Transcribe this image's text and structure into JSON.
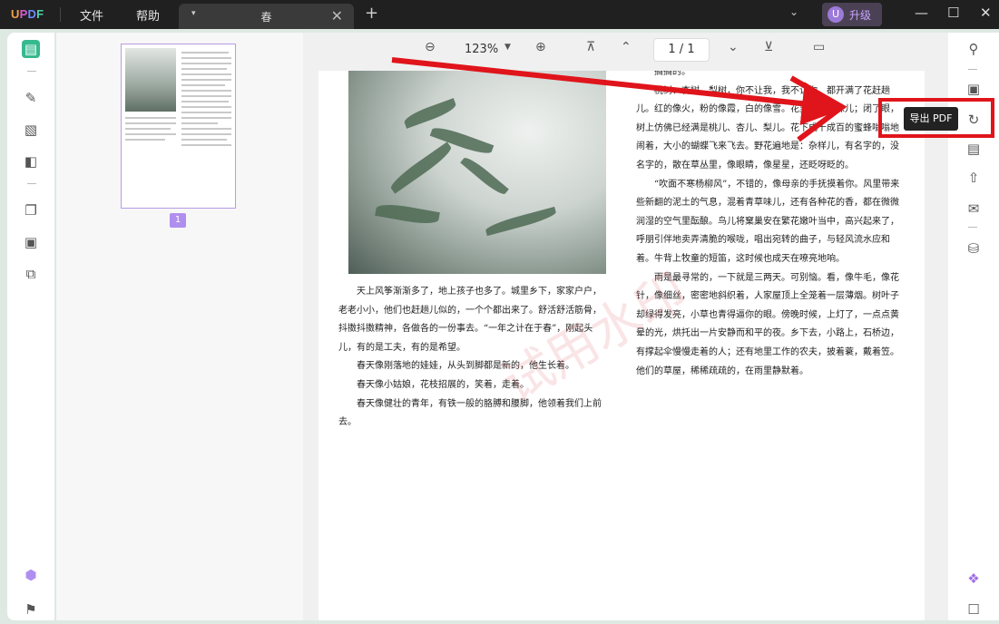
{
  "titlebar": {
    "logo": {
      "u": "U",
      "p": "P",
      "d": "D",
      "f": "F"
    },
    "menus": [
      "文件",
      "帮助"
    ],
    "tab_title": "春",
    "tab_arrow": "▾",
    "close_glyph": "✕",
    "new_tab": "+",
    "avatar_letter": "U",
    "upgrade_label": "升级"
  },
  "toolbar": {
    "zoom_label": "123%",
    "page_label": "1 / 1"
  },
  "thumbnail": {
    "page_number": "1"
  },
  "tooltip": {
    "label": "导出 PDF"
  },
  "document": {
    "left_paragraphs": [
      "天上风筝渐渐多了，地上孩子也多了。城里乡下，家家户户，老老小小，他们也赶趟儿似的，一个个都出来了。舒活舒活筋骨，抖擞抖擞精神，各做各的一份事去。“一年之计在于春”，刚起头儿，有的是工夫，有的是希望。",
      "春天像刚落地的娃娃，从头到脚都是新的，他生长着。",
      "春天像小姑娘，花枝招展的，笑着，走着。",
      "春天像健壮的青年，有铁一般的胳膊和腰脚，他领着我们上前去。"
    ],
    "right_paragraphs": [
      "搁搁的。",
      "桃树、杏树、梨树，你不让我，我不让你，都开满了花赶趟儿。红的像火，粉的像霞，白的像雪。花里带着甜味儿；闭了眼，树上仿佛已经满是桃儿、杏儿、梨儿。花下成千成百的蜜蜂嗡嗡地闹着，大小的蝴蝶飞来飞去。野花遍地是：杂样儿，有名字的，没名字的，散在草丛里，像眼睛，像星星，还眨呀眨的。",
      "“吹面不寒杨柳风”，不错的，像母亲的手抚摸着你。风里带来些新翻的泥土的气息，混着青草味儿，还有各种花的香，都在微微润湿的空气里酝酿。鸟儿将窠巢安在繁花嫩叶当中，高兴起来了，呼朋引伴地卖弄清脆的喉咙，唱出宛转的曲子，与轻风流水应和着。牛背上牧童的短笛，这时候也成天在嘹亮地响。",
      "雨是最寻常的，一下就是三两天。可别恼。看，像牛毛，像花针，像细丝，密密地斜织着，人家屋顶上全笼着一层薄烟。树叶子却绿得发亮，小草也青得逼你的眼。傍晚时候，上灯了，一点点黄晕的光，烘托出一片安静而和平的夜。乡下去，小路上，石桥边，有撑起伞慢慢走着的人；还有地里工作的农夫，披着蓑，戴着笠。他们的草屋，稀稀疏疏的，在雨里静默着。"
    ],
    "watermark": "试用水印"
  },
  "colors": {
    "accent": "#35b98e",
    "highlight": "#e0141b",
    "arrow": "#e0141b",
    "thumb_border": "#b79be6"
  }
}
